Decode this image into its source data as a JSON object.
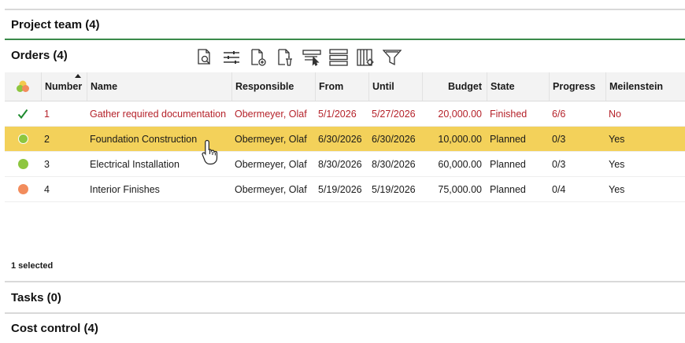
{
  "sections": {
    "project_team": "Project team (4)",
    "orders": "Orders (4)",
    "tasks": "Tasks (0)",
    "cost_control": "Cost control (4)"
  },
  "toolbar": {
    "icons": [
      "document-search-icon",
      "sliders-icon",
      "add-document-icon",
      "delete-document-icon",
      "select-columns-icon",
      "list-rows-icon",
      "column-settings-icon",
      "filter-icon"
    ]
  },
  "table": {
    "columns": {
      "number": "Number",
      "name": "Name",
      "responsible": "Responsible",
      "from": "From",
      "until": "Until",
      "budget": "Budget",
      "state": "State",
      "progress": "Progress",
      "milestone": "Meilenstein"
    },
    "rows": [
      {
        "status": "check",
        "number": "1",
        "name": "Gather required documentation",
        "responsible": "Obermeyer, Olaf",
        "from": "5/1/2026",
        "until": "5/27/2026",
        "budget": "20,000.00",
        "state": "Finished",
        "progress": "6/6",
        "milestone": "No"
      },
      {
        "status": "green",
        "number": "2",
        "name": "Foundation Construction",
        "responsible": "Obermeyer, Olaf",
        "from": "6/30/2026",
        "until": "6/30/2026",
        "budget": "10,000.00",
        "state": "Planned",
        "progress": "0/3",
        "milestone": "Yes"
      },
      {
        "status": "green",
        "number": "3",
        "name": "Electrical Installation",
        "responsible": "Obermeyer, Olaf",
        "from": "8/30/2026",
        "until": "8/30/2026",
        "budget": "60,000.00",
        "state": "Planned",
        "progress": "0/3",
        "milestone": "Yes"
      },
      {
        "status": "orange",
        "number": "4",
        "name": "Interior Finishes",
        "responsible": "Obermeyer, Olaf",
        "from": "5/19/2026",
        "until": "5/19/2026",
        "budget": "75,000.00",
        "state": "Planned",
        "progress": "0/4",
        "milestone": "Yes"
      }
    ]
  },
  "status_bar": {
    "selected": "1 selected"
  },
  "colors": {
    "selected_row": "#f3d15a",
    "finished_text": "#b5222a",
    "accent_line": "#3a8a4a",
    "dot_green": "#8dc63f",
    "dot_orange": "#f28c5c"
  }
}
